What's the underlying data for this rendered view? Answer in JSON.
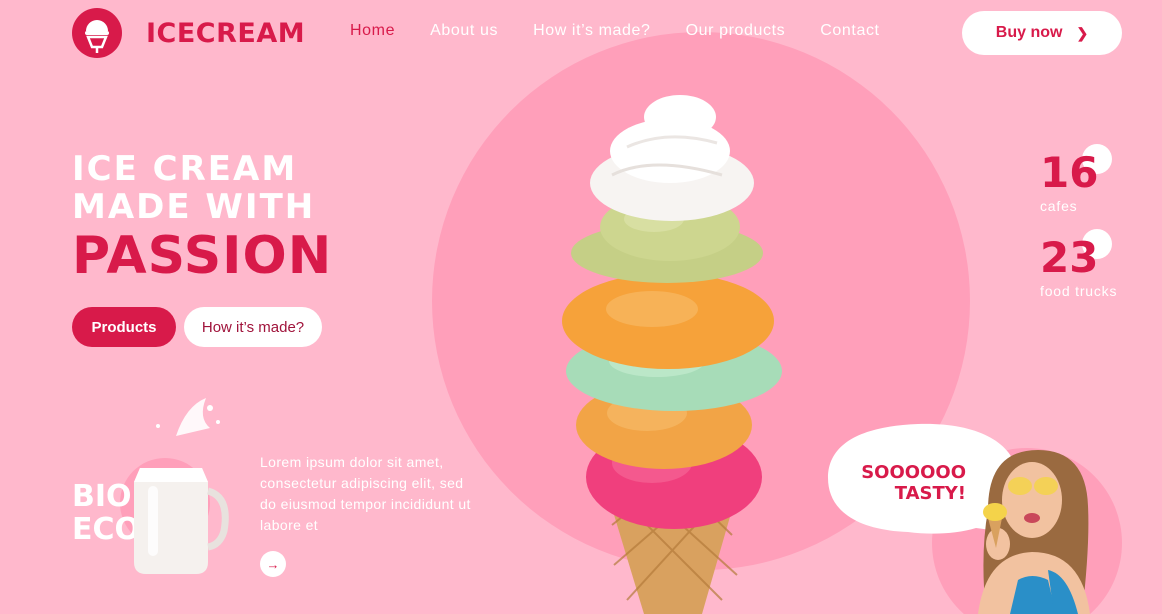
{
  "brand": {
    "name": "ICECREAM",
    "icon": "ice-cream-cone-icon"
  },
  "nav": {
    "items": [
      {
        "label": "Home",
        "active": true
      },
      {
        "label": "About us",
        "active": false
      },
      {
        "label": "How it’s made?",
        "active": false
      },
      {
        "label": "Our products",
        "active": false
      },
      {
        "label": "Contact",
        "active": false
      }
    ],
    "buy_label": "Buy now",
    "buy_icon": "chevron-right-icon"
  },
  "hero": {
    "line1": "ICE CREAM",
    "line2": "MADE WITH",
    "line3": "PASSION",
    "primary_cta": "Products",
    "secondary_cta": "How it’s made?"
  },
  "stats": [
    {
      "value": "16",
      "label": "cafes"
    },
    {
      "value": "23",
      "label": "food trucks"
    }
  ],
  "feature": {
    "line1": "BIO",
    "line2": "ECO",
    "text": "Lorem ipsum dolor sit amet, consectetur adipiscing elit, sed do eiusmod tempor incididunt ut labore et",
    "arrow_icon": "arrow-right-icon"
  },
  "testimonial": {
    "line1": "SOOOOOO",
    "line2": "TASTY!"
  },
  "colors": {
    "background": "#ffb8cc",
    "circle": "#ff9fba",
    "accent": "#d81a4a",
    "white": "#ffffff"
  }
}
